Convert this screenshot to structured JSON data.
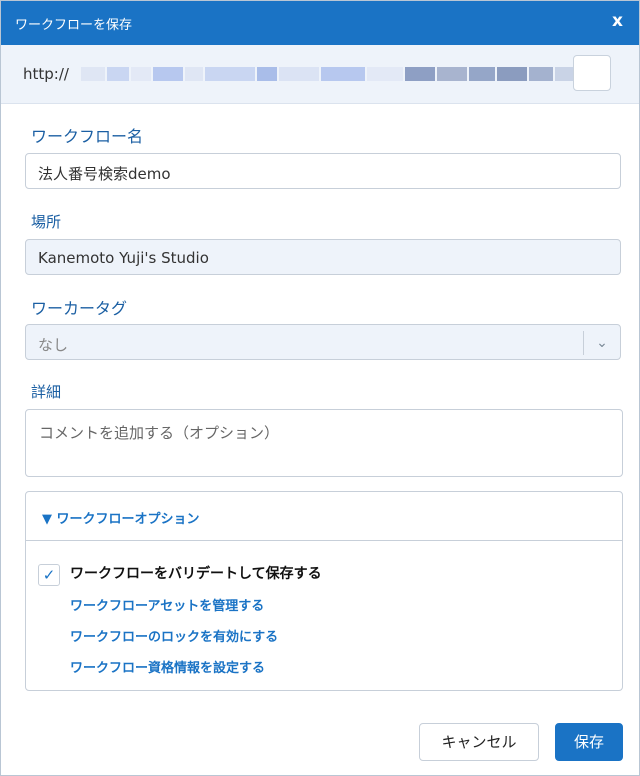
{
  "dialog": {
    "title": "ワークフローを保存",
    "close_label": "x"
  },
  "url": {
    "prefix": "http://"
  },
  "form": {
    "name_label": "ワークフロー名",
    "name_value": "法人番号検索demo",
    "location_label": "場所",
    "location_value": "Kanemoto Yuji's Studio",
    "worker_tag_label": "ワーカータグ",
    "worker_tag_value": "なし",
    "details_label": "詳細",
    "details_placeholder": "コメントを追加する（オプション）"
  },
  "options": {
    "header": "▼ ワークフローオプション",
    "validate_label": "ワークフローをバリデートして保存する",
    "validate_checked": true,
    "links": [
      "ワークフローアセットを管理する",
      "ワークフローのロックを有効にする",
      "ワークフロー資格情報を設定する"
    ]
  },
  "buttons": {
    "cancel": "キャンセル",
    "save": "保存"
  },
  "icons": {
    "dropdown": "chevron-down-icon",
    "checkbox": "checkmark-icon"
  }
}
